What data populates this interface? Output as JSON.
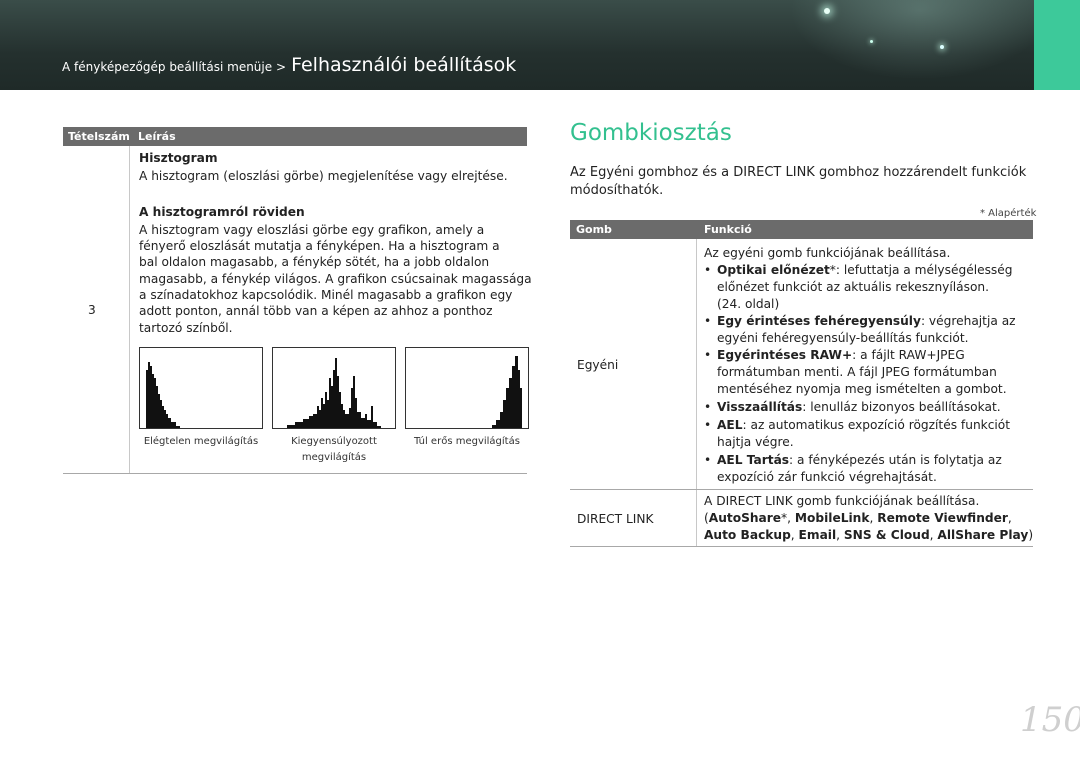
{
  "header": {
    "breadcrumb_small": "A fényképezőgép beállítási menüje >",
    "breadcrumb_big": "Felhasználói beállítások",
    "accent_color": "#3dc99a"
  },
  "left_table": {
    "col1": "Tételszám",
    "col2": "Leírás",
    "item_number": "3",
    "histogram_title": "Hisztogram",
    "histogram_desc": "A hisztogram (eloszlási görbe) megjelenítése vagy elrejtése.",
    "about_title": "A hisztogramról röviden",
    "about_lines": [
      "A hisztogram vagy eloszlási görbe egy grafikon, amely a",
      "fényerő eloszlását mutatja a fényképen. Ha a hisztogram a",
      "bal oldalon magasabb, a fénykép sötét, ha a jobb oldalon",
      "magasabb, a fénykép világos. A grafikon csúcsainak magassága",
      "a színadatokhoz kapcsolódik. Minél magasabb a grafikon egy",
      "adott ponton, annál több van a képen az ahhoz a ponthoz",
      "tartozó színből."
    ],
    "captions": {
      "under": "Elégtelen megvilágítás",
      "balanced_1": "Kiegyensúlyozott",
      "balanced_2": "megvilágítás",
      "over": "Túl erős megvilágítás"
    }
  },
  "right": {
    "title": "Gombkiosztás",
    "intro_1": "Az Egyéni gombhoz és a DIRECT LINK gombhoz hozzárendelt funkciók",
    "intro_2": "módosíthatók.",
    "default_note": "* Alapérték",
    "col1": "Gomb",
    "col2": "Funkció",
    "egyeni": {
      "label": "Egyéni",
      "lead": "Az egyéni gomb funkciójának beállítása.",
      "b1_bold": "Optikai előnézet",
      "b1_rest": "*: lefuttatja a mélységélesség",
      "b1_l2": "előnézet funkciót az aktuális rekesznyíláson.",
      "b1_l3": "(24. oldal)",
      "b2_bold": "Egy érintéses fehéregyensúly",
      "b2_rest": ": végrehajtja az",
      "b2_l2": "egyéni fehéregyensúly-beállítás funkciót.",
      "b3_bold": "Egyérintéses RAW+",
      "b3_rest": ": a fájlt RAW+JPEG",
      "b3_l2": "formátumban menti. A fájl JPEG formátumban",
      "b3_l3": "mentéséhez nyomja meg ismételten a gombot.",
      "b4_bold": "Visszaállítás",
      "b4_rest": ": lenulláz bizonyos beállításokat.",
      "b5_bold": "AEL",
      "b5_rest": ": az automatikus expozíció rögzítés funkciót",
      "b5_l2": "hajtja végre.",
      "b6_bold": "AEL Tartás",
      "b6_rest": ": a fényképezés után is folytatja az",
      "b6_l2": "expozíció zár funkció végrehajtását."
    },
    "directlink": {
      "label": "DIRECT LINK",
      "lead": "A DIRECT LINK gomb funkciójának beállítása.",
      "paren_open": "(",
      "opt1": "AutoShare",
      "star_sep": "*, ",
      "opt2": "MobileLink",
      "sep": ", ",
      "opt3": "Remote Viewfinder",
      "trail": ",",
      "opt4": "Auto Backup",
      "opt5": "Email",
      "opt6": "SNS & Cloud",
      "opt7": "AllShare Play",
      "paren_close": ")"
    }
  },
  "page_number": "150"
}
